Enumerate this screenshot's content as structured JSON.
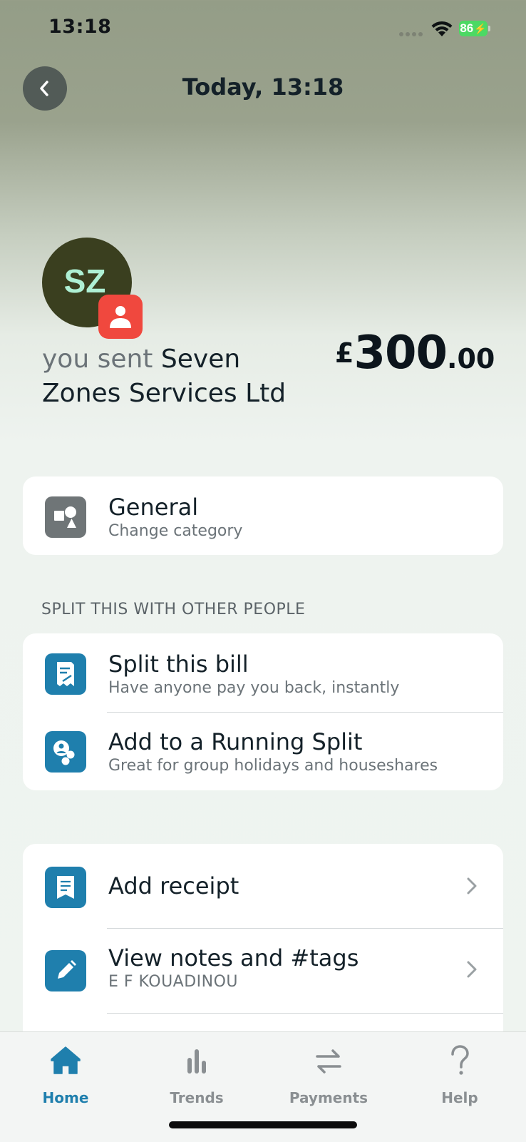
{
  "status_bar": {
    "time": "13:18",
    "battery": "86"
  },
  "header": {
    "title": "Today, 13:18"
  },
  "transaction": {
    "avatar_initials": "SZ",
    "sent_prefix": "you sent",
    "recipient": "Seven Zones Services Ltd",
    "amount_currency": "£",
    "amount_major": "300",
    "amount_minor": ".00"
  },
  "category": {
    "title": "General",
    "subtitle": "Change category"
  },
  "split_section": {
    "label": "SPLIT THIS WITH OTHER PEOPLE",
    "items": [
      {
        "title": "Split this bill",
        "subtitle": "Have anyone pay you back, instantly"
      },
      {
        "title": "Add to a Running Split",
        "subtitle": "Great for group holidays and houseshares"
      }
    ]
  },
  "actions": {
    "items": [
      {
        "title": "Add receipt"
      },
      {
        "title": "View notes and #tags",
        "subtitle": "E F KOUADINOU"
      }
    ]
  },
  "tabbar": {
    "tabs": [
      {
        "label": "Home",
        "icon": "home-icon",
        "active": true
      },
      {
        "label": "Trends",
        "icon": "bar-chart-icon",
        "active": false
      },
      {
        "label": "Payments",
        "icon": "transfer-arrows-icon",
        "active": false
      },
      {
        "label": "Help",
        "icon": "question-mark-icon",
        "active": false
      }
    ]
  },
  "colors": {
    "accent": "#1f7fad",
    "avatar_bg": "#3a3f1f",
    "avatar_text": "#aef0d4",
    "badge": "#f0483e",
    "battery": "#4cd964"
  }
}
